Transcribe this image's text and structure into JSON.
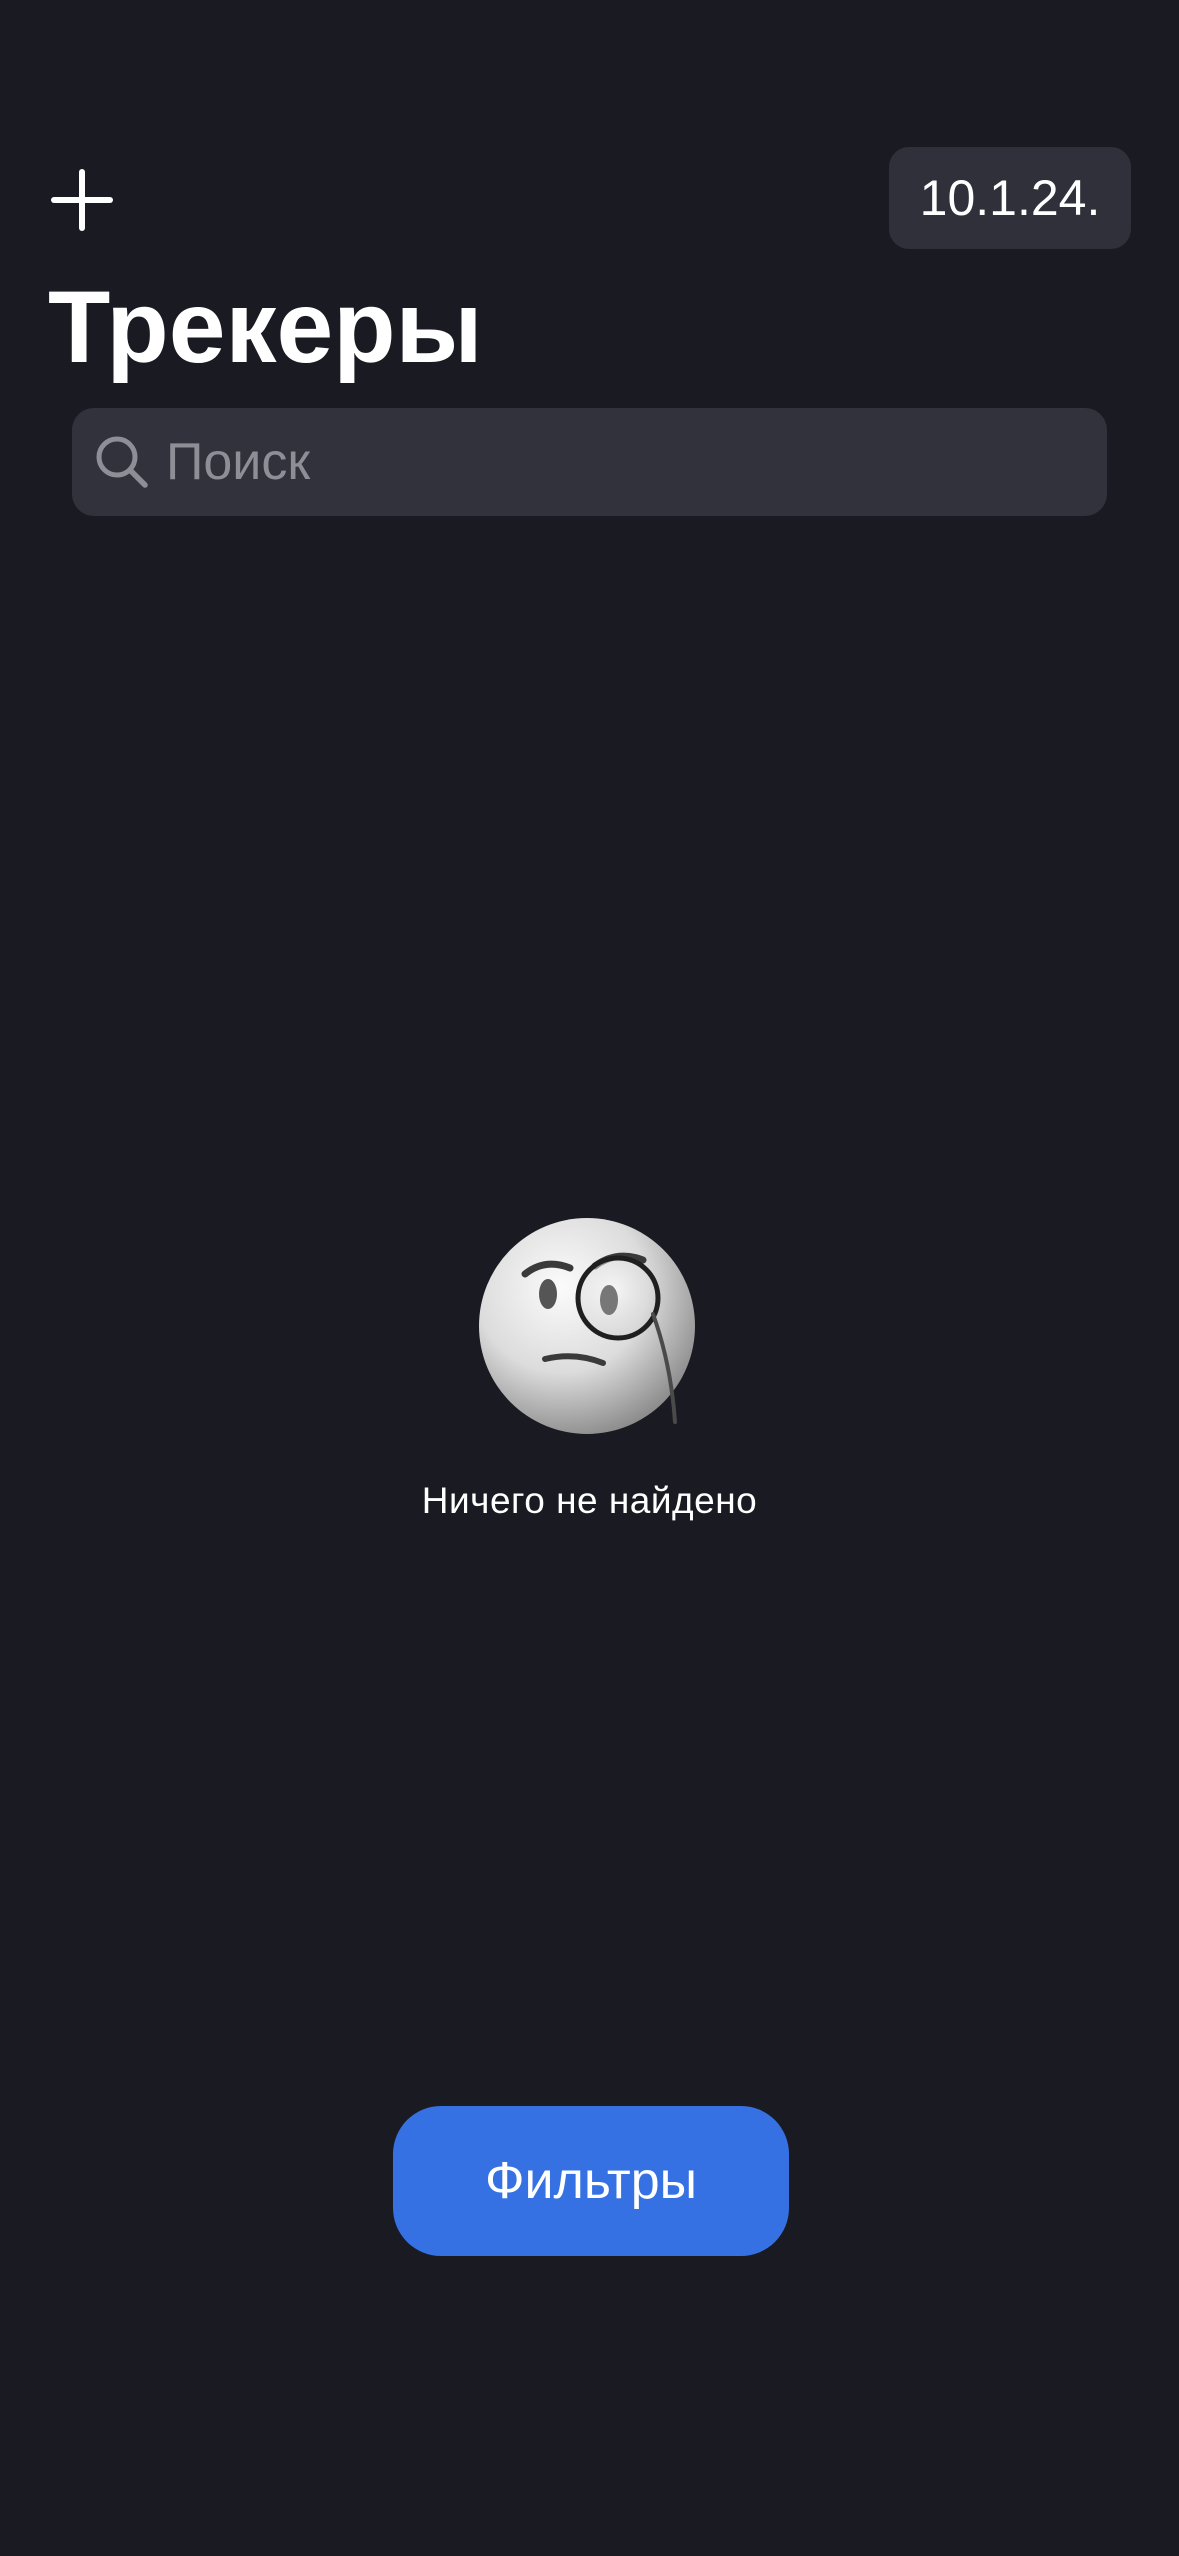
{
  "header": {
    "add_icon": "plus-icon",
    "date": "10.1.24.",
    "title": "Трекеры"
  },
  "search": {
    "placeholder": "Поиск",
    "value": "",
    "icon": "magnifier-icon"
  },
  "empty_state": {
    "icon": "face-with-monocle-emoji",
    "text": "Ничего не найдено"
  },
  "filters_button": {
    "label": "Фильтры"
  },
  "colors": {
    "background": "#1a1b22",
    "surface": "#31323b",
    "accent": "#3571e3",
    "placeholder": "#8e8e97",
    "text": "#ffffff"
  }
}
